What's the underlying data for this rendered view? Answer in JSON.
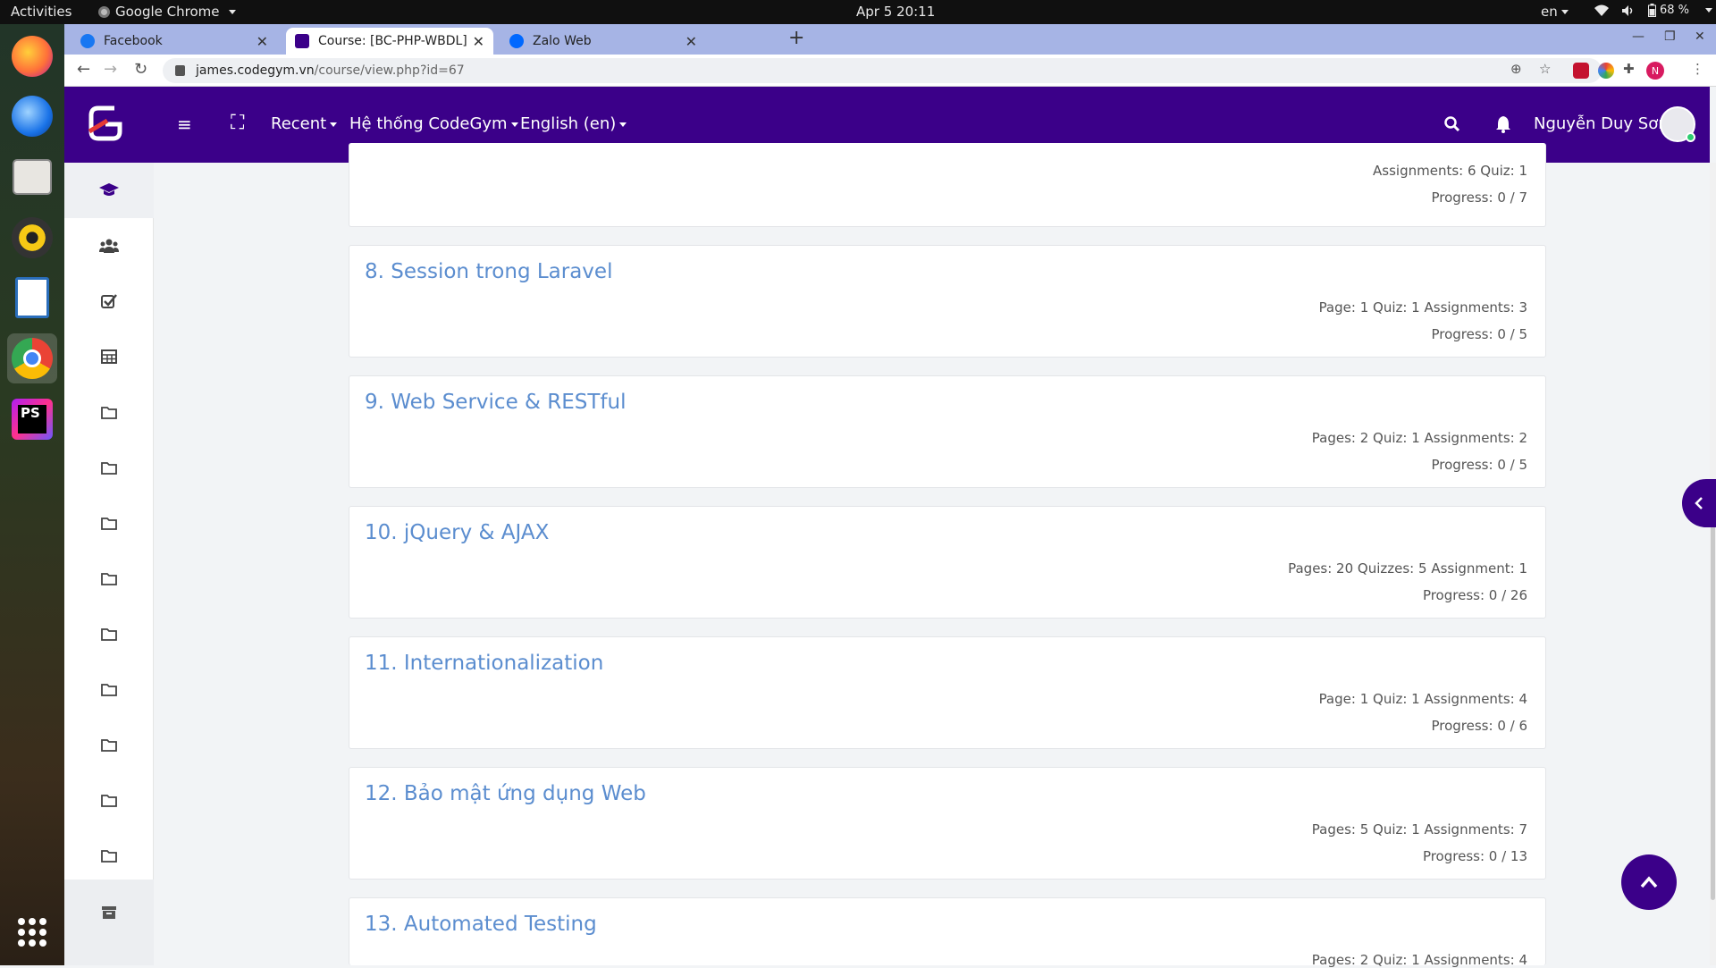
{
  "os": {
    "activities": "Activities",
    "app_menu": "Google Chrome",
    "clock": "Apr 5  20:11",
    "lang": "en",
    "battery": "68 %"
  },
  "browser": {
    "tabs": [
      {
        "title": "Facebook",
        "favicon_color": "#1877f2"
      },
      {
        "title": "Course: [BC-PHP-WBDL] W",
        "favicon_color": "#3b0089"
      },
      {
        "title": "Zalo Web",
        "favicon_color": "#0068ff"
      }
    ],
    "url_host": "james.codegym.vn",
    "url_path": "/course/view.php?id=67",
    "profile_initial": "N"
  },
  "navbar": {
    "recent": "Recent",
    "system": "Hệ thống CodeGym",
    "language": "English (en)",
    "user_name": "Nguyễn Duy Sơn"
  },
  "colors": {
    "brand": "#3b0089",
    "link": "#5b8dcf"
  },
  "drawer": {
    "icons": [
      "graduation-cap-icon",
      "users-icon",
      "check-square-icon",
      "table-icon",
      "folder-icon",
      "folder-icon",
      "folder-icon",
      "folder-icon",
      "folder-icon",
      "folder-icon",
      "folder-icon",
      "folder-icon",
      "folder-icon",
      "archive-icon"
    ]
  },
  "sections": [
    {
      "name": "",
      "activities": "Assignments: 6  Quiz: 1",
      "progress": "Progress: 0 / 7"
    },
    {
      "name": "8. Session trong Laravel",
      "activities": "Page: 1  Quiz: 1  Assignments: 3",
      "progress": "Progress: 0 / 5"
    },
    {
      "name": "9. Web Service & RESTful",
      "activities": "Pages: 2  Quiz: 1  Assignments: 2",
      "progress": "Progress: 0 / 5"
    },
    {
      "name": "10. jQuery & AJAX",
      "activities": "Pages: 20  Quizzes: 5  Assignment: 1",
      "progress": "Progress: 0 / 26"
    },
    {
      "name": "11. Internationalization",
      "activities": "Page: 1  Quiz: 1  Assignments: 4",
      "progress": "Progress: 0 / 6"
    },
    {
      "name": "12. Bảo mật ứng dụng Web",
      "activities": "Pages: 5  Quiz: 1  Assignments: 7",
      "progress": "Progress: 0 / 13"
    },
    {
      "name": "13. Automated Testing",
      "activities": "Pages: 2  Quiz: 1  Assignments: 4",
      "progress": ""
    }
  ]
}
